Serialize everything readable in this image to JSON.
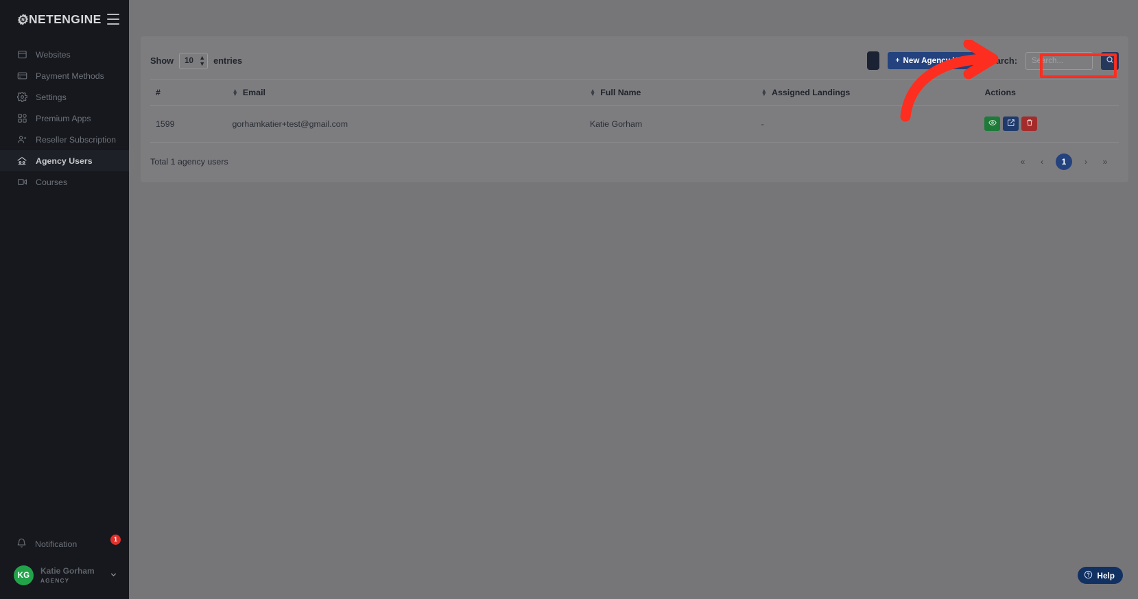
{
  "brand": {
    "name": "NETENGINE",
    "logo_icon": "gear-icon",
    "menu_icon": "hamburger-icon"
  },
  "sidebar": {
    "items": [
      {
        "label": "Websites",
        "icon": "window-icon",
        "active": false
      },
      {
        "label": "Payment Methods",
        "icon": "credit-card-icon",
        "active": false
      },
      {
        "label": "Settings",
        "icon": "gear-icon",
        "active": false
      },
      {
        "label": "Premium Apps",
        "icon": "apps-icon",
        "active": false
      },
      {
        "label": "Reseller Subscription",
        "icon": "user-plus-icon",
        "active": false
      },
      {
        "label": "Agency Users",
        "icon": "agency-icon",
        "active": true
      },
      {
        "label": "Courses",
        "icon": "video-icon",
        "active": false
      }
    ],
    "notification": {
      "label": "Notification",
      "icon": "bell-icon",
      "badge": "1"
    },
    "user": {
      "initials": "KG",
      "name": "Katie Gorham",
      "role": "AGENCY",
      "chevron_icon": "chevron-down-icon"
    }
  },
  "toolbar": {
    "show_label": "Show",
    "entries_label": "entries",
    "entries_value": "10",
    "secondary_button_label": "",
    "new_agency_user_label": "New Agency User",
    "new_agency_user_icon": "plus-icon",
    "search_label": "Search:",
    "search_placeholder": "Search...",
    "search_value": "",
    "search_button_icon": "search-icon"
  },
  "table": {
    "columns": [
      {
        "key": "id",
        "label": "#",
        "sortable": true
      },
      {
        "key": "email",
        "label": "Email",
        "sortable": true
      },
      {
        "key": "name",
        "label": "Full Name",
        "sortable": true
      },
      {
        "key": "landings",
        "label": "Assigned Landings",
        "sortable": false
      },
      {
        "key": "actions",
        "label": "Actions",
        "sortable": false
      }
    ],
    "rows": [
      {
        "id": "1599",
        "email": "gorhamkatier+test@gmail.com",
        "name": "Katie Gorham",
        "landings": "-",
        "actions": [
          {
            "name": "view-button",
            "icon": "eye-icon",
            "color": "#1e7a38"
          },
          {
            "name": "edit-button",
            "icon": "pencil-square-icon",
            "color": "#1f3a6b"
          },
          {
            "name": "delete-button",
            "icon": "trash-icon",
            "color": "#a32c2b"
          }
        ]
      }
    ]
  },
  "footer": {
    "total_text": "Total 1 agency users",
    "pagination": {
      "first": "«",
      "prev": "‹",
      "pages": [
        "1"
      ],
      "next": "›",
      "last": "»",
      "active_page": "1"
    }
  },
  "help": {
    "label": "Help",
    "icon": "question-circle-icon"
  },
  "annotation": {
    "highlight_target": "New Agency User",
    "highlight_color": "#fd2e1f",
    "arrow_color": "#fd2e1f"
  },
  "colors": {
    "sidebar_bg": "#16181d",
    "overlay_bg": "#767679",
    "card_bg": "#7d7d80",
    "primary": "#23427e",
    "danger": "#a32c2b",
    "success": "#1e7a38"
  }
}
